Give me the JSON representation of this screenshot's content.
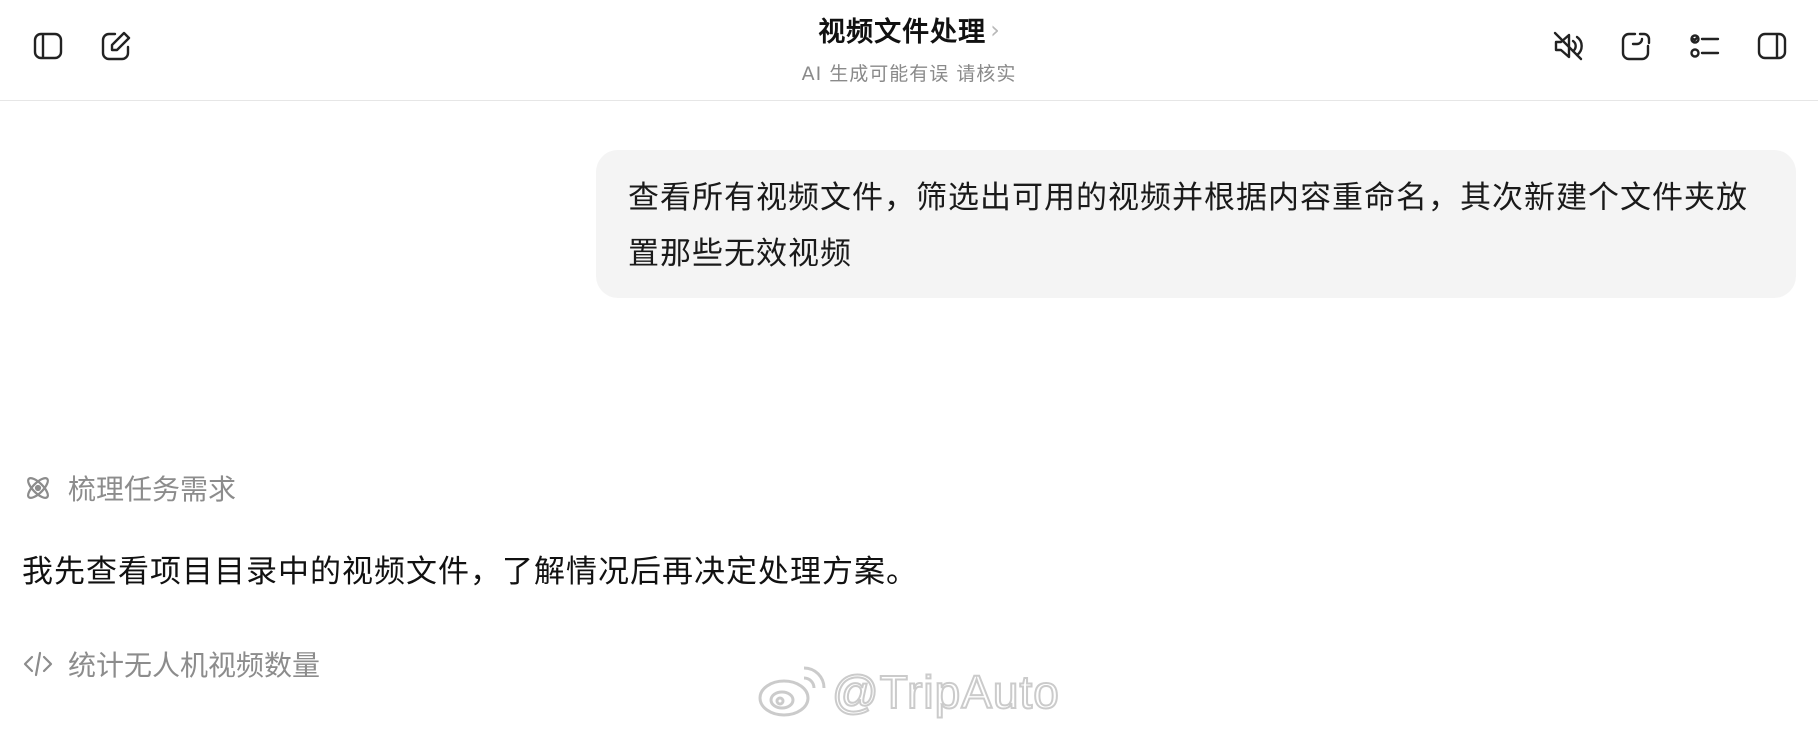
{
  "header": {
    "title": "视频文件处理",
    "title_chevron": "›",
    "subtitle": "AI 生成可能有误 请核实",
    "left_icons": [
      "sidebar-toggle-icon",
      "new-chat-icon"
    ],
    "right_icons": [
      "mute-icon",
      "new-window-icon",
      "task-list-icon",
      "right-panel-icon"
    ]
  },
  "conversation": {
    "user_message": "查看所有视频文件，筛选出可用的视频并根据内容重命名，其次新建个文件夹放置那些无效视频",
    "thinking_step": {
      "icon": "atom-icon",
      "label": "梳理任务需求"
    },
    "assistant_reply": "我先查看项目目录中的视频文件，了解情况后再决定处理方案。",
    "code_step": {
      "icon": "code-icon",
      "label": "统计无人机视频数量"
    }
  },
  "watermark": {
    "text": "@TripAuto",
    "icon": "weibo-logo-icon"
  },
  "colors": {
    "bubble_bg": "#f4f4f4",
    "muted_text": "#8c8c8c",
    "primary_text": "#111111",
    "divider": "#e6e6e6"
  }
}
